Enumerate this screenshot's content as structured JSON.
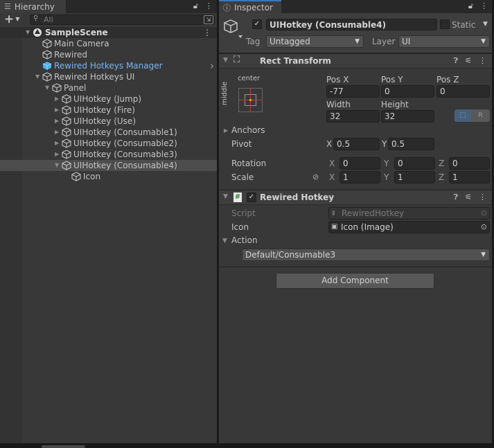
{
  "hierarchy": {
    "tab_label": "Hierarchy",
    "search_placeholder": "All",
    "add_label": "+",
    "rows": [
      {
        "label": "SampleScene",
        "level": 0,
        "icon": "unity-scene-icon",
        "expanded": true,
        "bold": true
      },
      {
        "label": "Main Camera",
        "level": 1,
        "icon": "gameobject-icon"
      },
      {
        "label": "Rewired",
        "level": 1,
        "icon": "gameobject-icon"
      },
      {
        "label": "Rewired Hotkeys Manager",
        "level": 1,
        "icon": "prefab-icon",
        "prefab": true
      },
      {
        "label": "Rewired Hotkeys UI",
        "level": 1,
        "icon": "gameobject-icon",
        "expanded": true
      },
      {
        "label": "Panel",
        "level": 2,
        "icon": "gameobject-icon",
        "expanded": true
      },
      {
        "label": "UIHotkey (Jump)",
        "level": 3,
        "icon": "gameobject-icon",
        "collapsed": true
      },
      {
        "label": "UIHotkey (Fire)",
        "level": 3,
        "icon": "gameobject-icon",
        "collapsed": true
      },
      {
        "label": "UIHotkey (Use)",
        "level": 3,
        "icon": "gameobject-icon",
        "collapsed": true
      },
      {
        "label": "UIHotkey (Consumable1)",
        "level": 3,
        "icon": "gameobject-icon",
        "collapsed": true
      },
      {
        "label": "UIHotkey (Consumable2)",
        "level": 3,
        "icon": "gameobject-icon",
        "collapsed": true
      },
      {
        "label": "UIHotkey (Consumable3)",
        "level": 3,
        "icon": "gameobject-icon",
        "collapsed": true
      },
      {
        "label": "UIHotkey (Consumable4)",
        "level": 3,
        "icon": "gameobject-icon",
        "expanded": true,
        "selected": true
      },
      {
        "label": "Icon",
        "level": 4,
        "icon": "gameobject-icon"
      }
    ]
  },
  "inspector": {
    "tab_label": "Inspector",
    "object_name": "UIHotkey (Consumable4)",
    "static_label": "Static",
    "tag_label": "Tag",
    "tag_value": "Untagged",
    "layer_label": "Layer",
    "layer_value": "UI",
    "rect_transform": {
      "title": "Rect Transform",
      "anchor_h": "center",
      "anchor_v": "middle",
      "pos_x_label": "Pos X",
      "pos_x": "-77",
      "pos_y_label": "Pos Y",
      "pos_y": "0",
      "pos_z_label": "Pos Z",
      "pos_z": "0",
      "width_label": "Width",
      "width": "32",
      "height_label": "Height",
      "height": "32",
      "raw_label": "R",
      "anchors_label": "Anchors",
      "pivot_label": "Pivot",
      "pivot_x": "0.5",
      "pivot_y": "0.5",
      "rotation_label": "Rotation",
      "rot_x": "0",
      "rot_y": "0",
      "rot_z": "0",
      "scale_label": "Scale",
      "scale_x": "1",
      "scale_y": "1",
      "scale_z": "1",
      "x": "X",
      "y": "Y",
      "z": "Z"
    },
    "rewired_hotkey": {
      "title": "Rewired Hotkey",
      "script_label": "Script",
      "script_value": "RewiredHotkey",
      "icon_label": "Icon",
      "icon_value": "Icon (Image)",
      "action_label": "Action",
      "action_value": "Default/Consumable3"
    },
    "add_component": "Add Component"
  },
  "colors": {
    "prefab": "#7cb4f2",
    "selection": "#4d4d4d",
    "panel": "#383838"
  }
}
